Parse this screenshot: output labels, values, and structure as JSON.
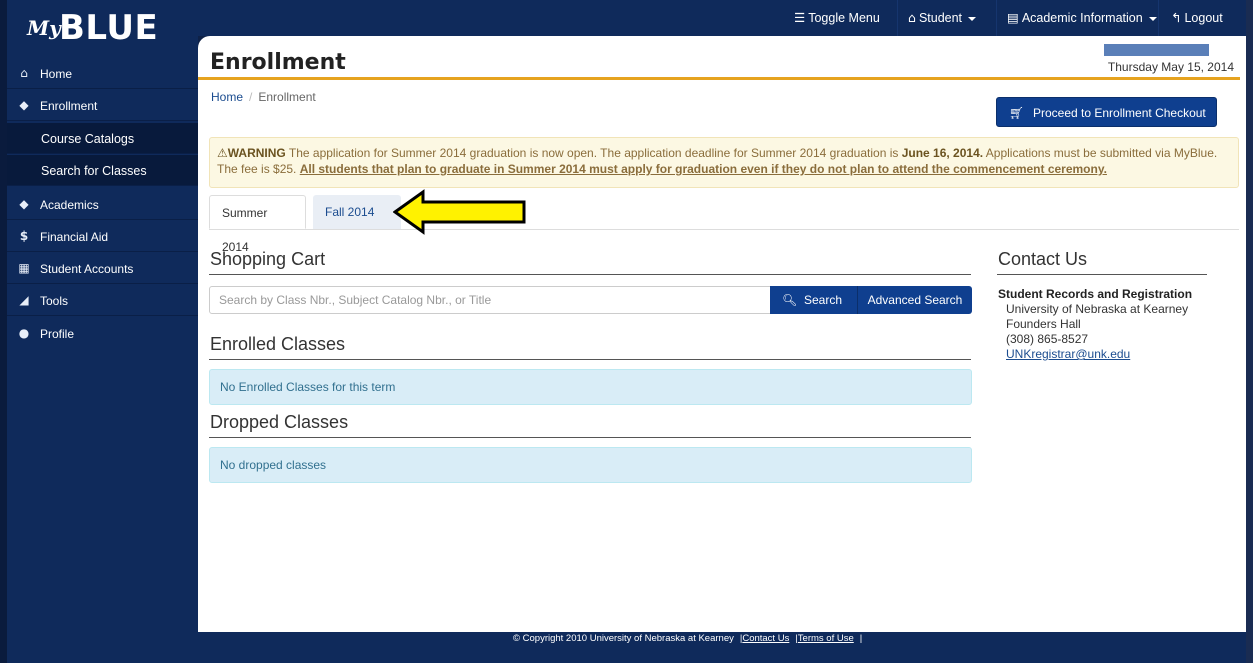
{
  "brand": {
    "my": "My",
    "blue": "BLUE"
  },
  "sidebar": {
    "items": [
      {
        "label": "Home",
        "icon": "home-icon",
        "glyph": "⌂"
      },
      {
        "label": "Enrollment",
        "icon": "graduation-cap-icon",
        "glyph": "◆"
      },
      {
        "label": "Course Catalogs",
        "sub": true
      },
      {
        "label": "Search for Classes",
        "sub": true
      },
      {
        "label": "Academics",
        "icon": "graduation-cap-icon",
        "glyph": "◆"
      },
      {
        "label": "Financial Aid",
        "icon": "dollar-icon",
        "glyph": "$"
      },
      {
        "label": "Student Accounts",
        "icon": "calculator-icon",
        "glyph": "▦"
      },
      {
        "label": "Tools",
        "icon": "wrench-icon",
        "glyph": "◢"
      },
      {
        "label": "Profile",
        "icon": "user-icon",
        "glyph": "●"
      }
    ]
  },
  "topbar": {
    "toggle": "Toggle Menu",
    "student": "Student",
    "academic": "Academic Information",
    "logout": "Logout"
  },
  "page": {
    "title": "Enrollment",
    "date": "Thursday May 15, 2014",
    "breadcrumb_home": "Home",
    "breadcrumb_current": "Enrollment",
    "checkout": "Proceed to Enrollment Checkout"
  },
  "warning": {
    "label": "WARNING",
    "text1": " The application for Summer 2014 graduation is now open. The application deadline for Summer 2014 graduation is ",
    "deadline": "June 16, 2014.",
    "text2": " Applications must be submitted via MyBlue. The fee is $25. ",
    "emphasis": "All students that plan to graduate in Summer 2014 must apply for graduation even if they do not plan to attend the commencement ceremony."
  },
  "tabs": [
    {
      "label": "Summer 2014"
    },
    {
      "label": "Fall 2014"
    }
  ],
  "cart": {
    "heading": "Shopping Cart",
    "search_placeholder": "Search by Class Nbr., Subject Catalog Nbr., or Title",
    "search_label": "Search",
    "advanced_label": "Advanced Search"
  },
  "enrolled": {
    "heading": "Enrolled Classes",
    "empty": "No Enrolled Classes for this term"
  },
  "dropped": {
    "heading": "Dropped Classes",
    "empty": "No dropped classes"
  },
  "contact": {
    "heading": "Contact Us",
    "org": "Student Records and Registration",
    "lines": [
      "University of Nebraska at Kearney",
      "Founders Hall",
      "(308) 865-8527"
    ],
    "email": "UNKregistrar@unk.edu"
  },
  "footer": {
    "copyright": "© Copyright 2010 University of Nebraska at Kearney",
    "contact": "Contact Us",
    "terms": "Terms of Use"
  },
  "colors": {
    "navy": "#0f2a5b",
    "accent_gold": "#e6a31f",
    "button_blue": "#0f3f8f",
    "arrow_yellow": "#fff200"
  }
}
